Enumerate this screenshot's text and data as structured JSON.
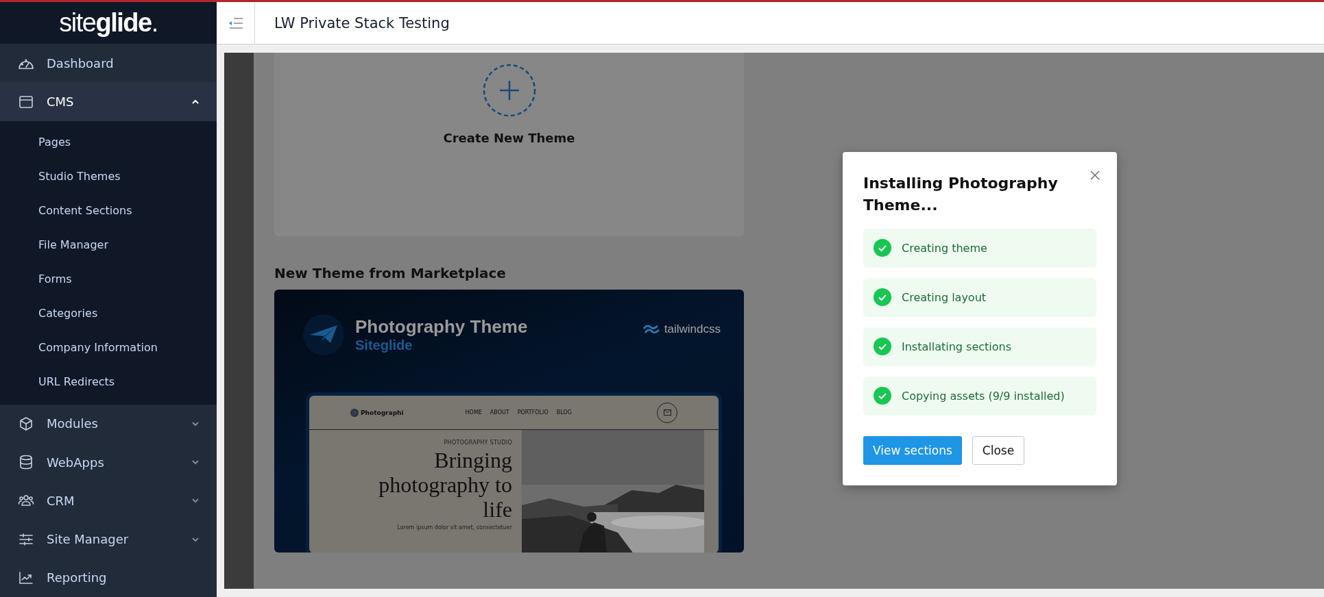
{
  "sidebar": {
    "logo": "site**glide**.",
    "items": [
      {
        "label": "Dashboard"
      },
      {
        "label": "CMS",
        "expanded": true,
        "children": [
          {
            "label": "Pages"
          },
          {
            "label": "Studio Themes"
          },
          {
            "label": "Content Sections"
          },
          {
            "label": "File Manager"
          },
          {
            "label": "Forms"
          },
          {
            "label": "Categories"
          },
          {
            "label": "Company Information"
          },
          {
            "label": "URL Redirects"
          }
        ]
      },
      {
        "label": "Modules",
        "expanded": false
      },
      {
        "label": "WebApps",
        "expanded": false
      },
      {
        "label": "CRM",
        "expanded": false
      },
      {
        "label": "Site Manager",
        "expanded": false
      },
      {
        "label": "Reporting"
      }
    ]
  },
  "header": {
    "title": "LW Private Stack Testing"
  },
  "create_card": {
    "label": "Create New Theme"
  },
  "marketplace": {
    "heading": "New Theme from Marketplace",
    "preview": {
      "title": "Photography Theme",
      "subtitle": "Siteglide",
      "brand": "tailwindcss",
      "site_name": "Photographi",
      "nav": [
        "HOME",
        "ABOUT",
        "PORTFOLIO",
        "BLOG"
      ],
      "eyebrow": "PHOTOGRAPHY STUDIO",
      "headline": "Bringing photography to life",
      "body": "Lorem ipsum dolor sit amet, consectetuer"
    }
  },
  "modal": {
    "title": "Installing Photography Theme...",
    "steps": [
      {
        "label": "Creating theme",
        "done": true
      },
      {
        "label": "Creating layout",
        "done": true
      },
      {
        "label": "Installating sections",
        "done": true
      },
      {
        "label": "Copying assets (9/9 installed)",
        "done": true
      }
    ],
    "buttons": [
      {
        "label": "View sections",
        "kind": "primary"
      },
      {
        "label": "Close",
        "kind": "secondary"
      }
    ]
  }
}
